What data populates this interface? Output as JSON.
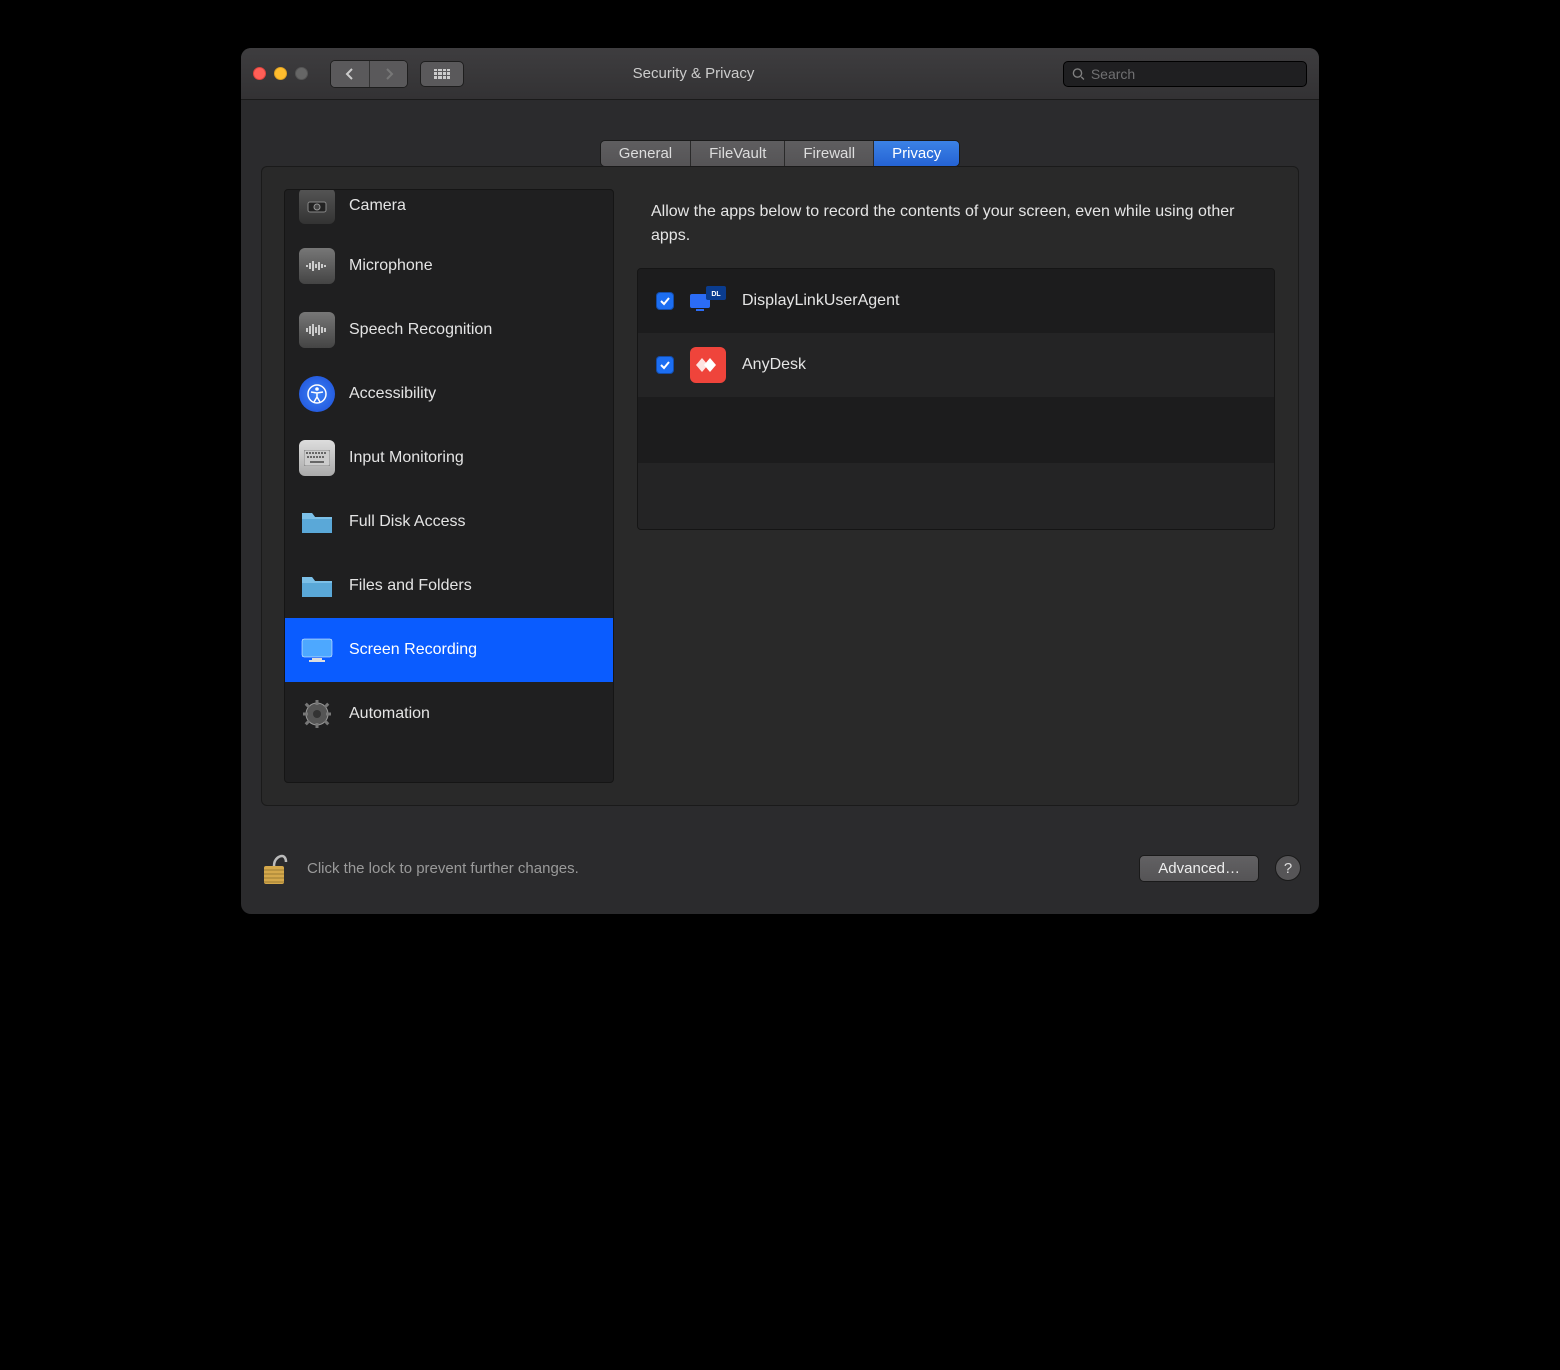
{
  "window": {
    "title": "Security & Privacy"
  },
  "search": {
    "placeholder": "Search"
  },
  "tabs": [
    {
      "label": "General",
      "active": false
    },
    {
      "label": "FileVault",
      "active": false
    },
    {
      "label": "Firewall",
      "active": false
    },
    {
      "label": "Privacy",
      "active": true
    }
  ],
  "sidebar": {
    "items": [
      {
        "label": "Camera",
        "icon": "camera",
        "selected": false
      },
      {
        "label": "Microphone",
        "icon": "microphone",
        "selected": false
      },
      {
        "label": "Speech Recognition",
        "icon": "waveform",
        "selected": false
      },
      {
        "label": "Accessibility",
        "icon": "accessibility",
        "selected": false
      },
      {
        "label": "Input Monitoring",
        "icon": "keyboard",
        "selected": false
      },
      {
        "label": "Full Disk Access",
        "icon": "folder",
        "selected": false
      },
      {
        "label": "Files and Folders",
        "icon": "folder",
        "selected": false
      },
      {
        "label": "Screen Recording",
        "icon": "display",
        "selected": true
      },
      {
        "label": "Automation",
        "icon": "gear",
        "selected": false
      }
    ]
  },
  "main": {
    "description": "Allow the apps below to record the contents of your screen, even while using other apps.",
    "apps": [
      {
        "name": "DisplayLinkUserAgent",
        "checked": true,
        "icon": "displaylink"
      },
      {
        "name": "AnyDesk",
        "checked": true,
        "icon": "anydesk"
      }
    ]
  },
  "footer": {
    "lock_text": "Click the lock to prevent further changes.",
    "advanced_label": "Advanced…",
    "help_label": "?"
  }
}
